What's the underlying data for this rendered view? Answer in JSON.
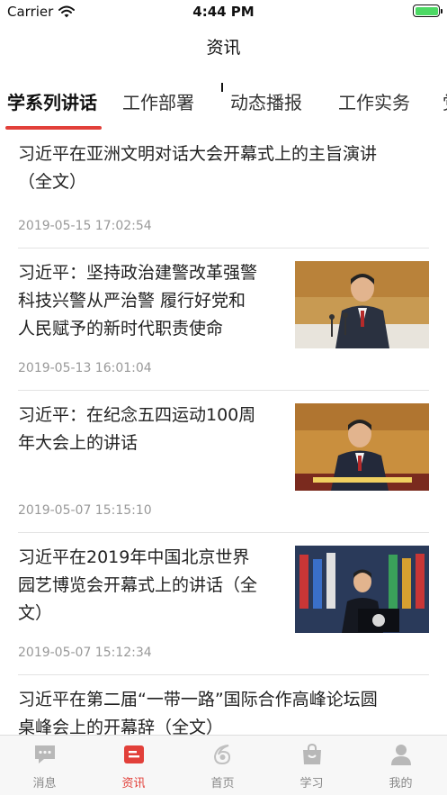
{
  "status_bar": {
    "carrier": "Carrier",
    "time": "4:44 PM",
    "wifi_icon": "wifi-icon",
    "battery_icon": "battery-icon"
  },
  "nav": {
    "title": "资讯"
  },
  "tabs": [
    {
      "label": "学系列讲话",
      "active": true
    },
    {
      "label": "工作部署",
      "active": false
    },
    {
      "label": "动态播报",
      "active": false
    },
    {
      "label": "工作实务",
      "active": false
    }
  ],
  "colors": {
    "accent": "#e2403a",
    "inactive": "#888888",
    "date": "#999999"
  },
  "news": [
    {
      "title_lines": [
        "习近平在亚洲文明对话大会开幕式上的主旨演讲",
        "（全文）"
      ],
      "date": "2019-05-15 17:02:54",
      "has_image": false
    },
    {
      "title_lines": [
        "习近平：坚持政治建警改革强警",
        "科技兴警从严治警 履行好党和",
        "人民赋予的新时代职责使命"
      ],
      "date": "2019-05-13 16:01:04",
      "has_image": true
    },
    {
      "title_lines": [
        "习近平：在纪念五四运动100周",
        "年大会上的讲话"
      ],
      "date": "2019-05-07 15:15:10",
      "has_image": true
    },
    {
      "title_lines": [
        "习近平在2019年中国北京世界",
        "园艺博览会开幕式上的讲话（全",
        "文）"
      ],
      "date": "2019-05-07 15:12:34",
      "has_image": true
    },
    {
      "title_lines": [
        "习近平在第二届“一带一路”国际合作高峰论坛圆",
        "桌峰会上的开幕辞（全文）"
      ],
      "date": "",
      "has_image": false
    }
  ],
  "tabbar": [
    {
      "label": "消息",
      "icon": "message-icon",
      "active": false
    },
    {
      "label": "资讯",
      "icon": "news-icon",
      "active": true
    },
    {
      "label": "首页",
      "icon": "home-icon",
      "active": false
    },
    {
      "label": "学习",
      "icon": "study-bag-icon",
      "active": false
    },
    {
      "label": "我的",
      "icon": "profile-icon",
      "active": false
    }
  ]
}
